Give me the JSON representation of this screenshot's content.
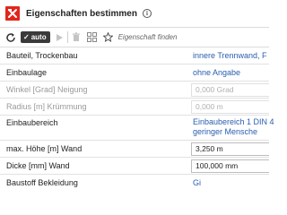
{
  "header": {
    "title": "Eigenschaften bestimmen"
  },
  "toolbar": {
    "auto_label": "auto",
    "search_placeholder": "Eigenschaft finden"
  },
  "colors": {
    "brand": "#e2261b",
    "link": "#2a5db0"
  },
  "rows": [
    {
      "label": "Bauteil, Trockenbau",
      "value": "innere Trennwand, F"
    },
    {
      "label": "Einbaulage",
      "value": "ohne Angabe"
    },
    {
      "label": "Winkel [Grad] Neigung",
      "value": "0,000 Grad"
    },
    {
      "label": "Radius [m] Krümmung",
      "value": "0,000 m"
    },
    {
      "label": "Einbaubereich",
      "value_line1": "Einbaubereich 1 DIN 4",
      "value_line2": "geringer Mensche"
    },
    {
      "label": "max. Höhe [m] Wand",
      "value": "3,250 m"
    },
    {
      "label": "Dicke [mm] Wand",
      "value": "100,000 mm"
    },
    {
      "label": "Baustoff Bekleidung",
      "value": "Gi"
    }
  ]
}
